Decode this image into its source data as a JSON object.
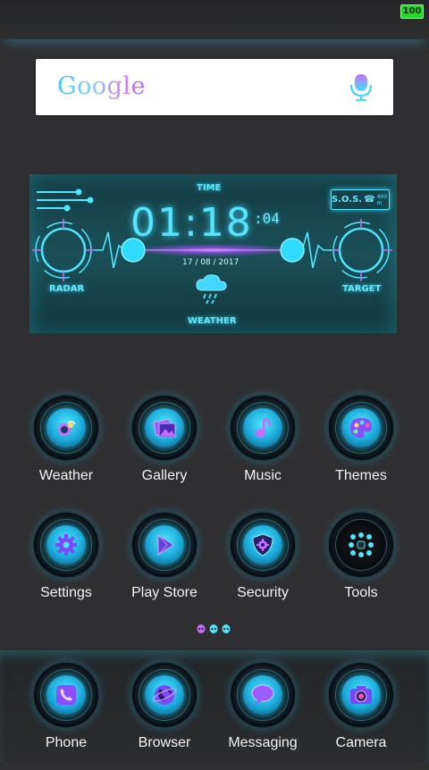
{
  "status_bar": {
    "battery": "100"
  },
  "search": {
    "logo": "Google",
    "mic_icon": "mic-icon"
  },
  "clock_widget": {
    "time_label": "TIME",
    "time": "01:18",
    "seconds": ":04",
    "date": "17 / 08 / 2017",
    "sos_label": "S.O.S.",
    "sos_distance": "400 m",
    "radar_label": "RADAR",
    "target_label": "TARGET",
    "weather_label": "WEATHER"
  },
  "apps": {
    "row1": [
      {
        "label": "Weather",
        "icon": "weather-icon"
      },
      {
        "label": "Gallery",
        "icon": "gallery-icon"
      },
      {
        "label": "Music",
        "icon": "music-icon"
      },
      {
        "label": "Themes",
        "icon": "themes-icon"
      }
    ],
    "row2": [
      {
        "label": "Settings",
        "icon": "settings-icon"
      },
      {
        "label": "Play Store",
        "icon": "play-store-icon"
      },
      {
        "label": "Security",
        "icon": "security-icon"
      },
      {
        "label": "Tools",
        "icon": "tools-icon"
      }
    ]
  },
  "page_indicator": {
    "count": 3,
    "active": 0
  },
  "dock": [
    {
      "label": "Phone",
      "icon": "phone-icon"
    },
    {
      "label": "Browser",
      "icon": "browser-icon"
    },
    {
      "label": "Messaging",
      "icon": "messaging-icon"
    },
    {
      "label": "Camera",
      "icon": "camera-icon"
    }
  ],
  "colors": {
    "accent": "#4de6ff",
    "secondary": "#c86cff",
    "background": "#2f2f31"
  }
}
